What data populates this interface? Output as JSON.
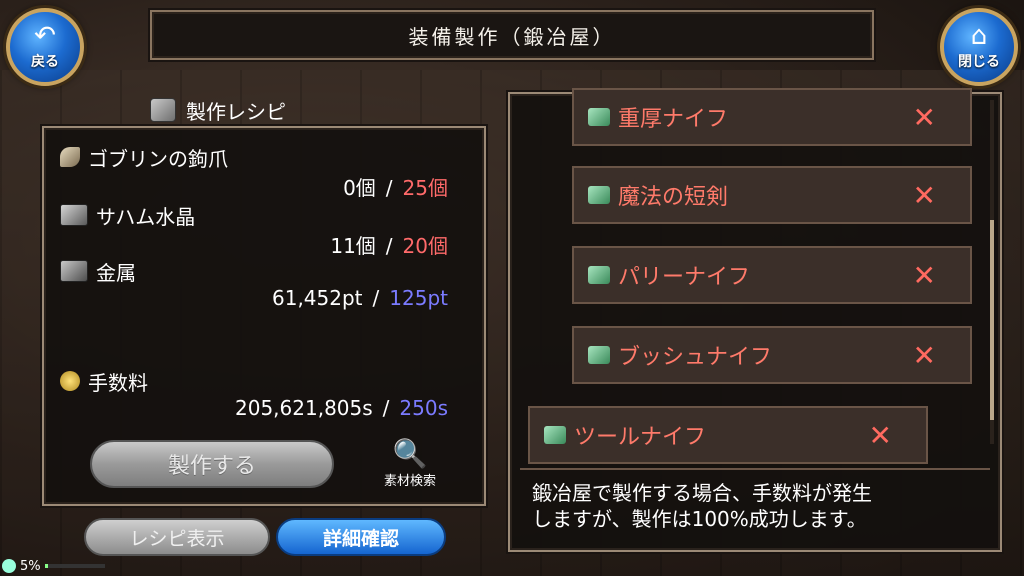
{
  "header": {
    "title": "装備製作（鍛冶屋）",
    "back_label": "戻る",
    "close_label": "閉じる"
  },
  "recipe": {
    "heading": "製作レシピ",
    "materials": [
      {
        "name": "ゴブリンの鉤爪",
        "have": "0個",
        "need": "25個",
        "icon": "claw-icon"
      },
      {
        "name": "サハム水晶",
        "have": "11個",
        "need": "20個",
        "icon": "crystal-icon"
      },
      {
        "name": "金属",
        "have": "61,452pt",
        "need": "125pt",
        "icon": "metal-icon"
      }
    ],
    "fee": {
      "name": "手数料",
      "have": "205,621,805s",
      "need": "250s"
    },
    "separator": "/",
    "make_label": "製作する",
    "search_label": "素材検索",
    "recipe_view_label": "レシピ表示",
    "detail_label": "詳細確認"
  },
  "list": {
    "items": [
      {
        "name": "重厚ナイフ",
        "mark": "✕"
      },
      {
        "name": "魔法の短剣",
        "mark": "✕"
      },
      {
        "name": "パリーナイフ",
        "mark": "✕"
      },
      {
        "name": "ブッシュナイフ",
        "mark": "✕"
      },
      {
        "name": "ツールナイフ",
        "mark": "✕"
      }
    ],
    "info_line1": "鍛冶屋で製作する場合、手数料が発生",
    "info_line2": "しますが、製作は100%成功します。"
  },
  "status": {
    "battery": "5%",
    "battery_level": 0.05
  },
  "colors": {
    "need_red": "#ff6a6a",
    "need_blue": "#7b7bff",
    "item_name": "#ff7a6a",
    "accent_blue": "#1565d0"
  }
}
